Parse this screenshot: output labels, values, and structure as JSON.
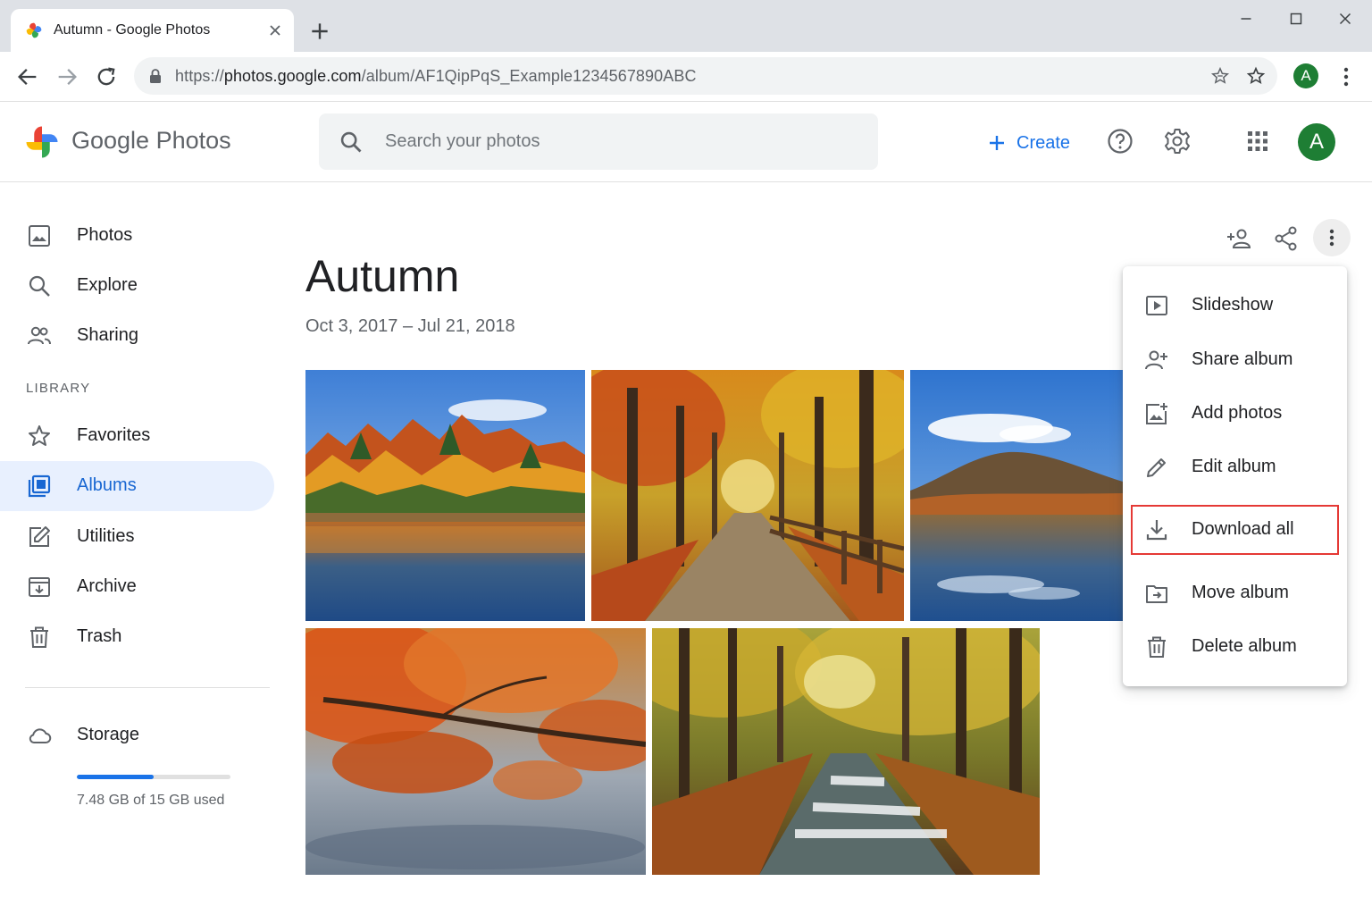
{
  "browser": {
    "tab_title": "Autumn - Google Photos",
    "url_prefix": "https://",
    "url_host": "photos.google.com",
    "url_path": "/album/AF1QipPqS_Example1234567890ABC",
    "profile_initial": "A"
  },
  "header": {
    "logo_text_google": "Google",
    "logo_text_photos": "Photos",
    "search_placeholder": "Search your photos",
    "create_label": "Create",
    "avatar_initial": "A",
    "accent_color": "#1a73e8"
  },
  "sidebar": {
    "items": [
      {
        "label": "Photos",
        "icon": "photo-icon"
      },
      {
        "label": "Explore",
        "icon": "search-icon"
      },
      {
        "label": "Sharing",
        "icon": "people-icon"
      }
    ],
    "library_heading": "LIBRARY",
    "library_items": [
      {
        "label": "Favorites",
        "icon": "star-icon"
      },
      {
        "label": "Albums",
        "icon": "albums-icon",
        "active": true
      },
      {
        "label": "Utilities",
        "icon": "utilities-icon"
      },
      {
        "label": "Archive",
        "icon": "archive-icon"
      },
      {
        "label": "Trash",
        "icon": "trash-icon"
      }
    ],
    "storage_label": "Storage",
    "storage_used_fraction": 0.5,
    "storage_text": "7.48 GB of 15 GB used"
  },
  "album": {
    "title": "Autumn",
    "dates": "Oct 3, 2017 – Jul 21, 2018",
    "photos": [
      {
        "subject": "lake-with-autumn-trees"
      },
      {
        "subject": "autumn-forest-path"
      },
      {
        "subject": "mountain-lake-reflection"
      },
      {
        "subject": "orange-maple-leaves"
      },
      {
        "subject": "forest-stream"
      }
    ]
  },
  "menu": {
    "items": [
      {
        "label": "Slideshow",
        "icon": "slideshow-icon"
      },
      {
        "label": "Share album",
        "icon": "share-album-icon"
      },
      {
        "label": "Add photos",
        "icon": "add-photos-icon"
      },
      {
        "label": "Edit album",
        "icon": "edit-icon"
      },
      {
        "label": "Download all",
        "icon": "download-icon",
        "highlighted": true
      },
      {
        "label": "Move album",
        "icon": "move-icon"
      },
      {
        "label": "Delete album",
        "icon": "trash-icon"
      }
    ],
    "highlight_color": "#e53935"
  }
}
